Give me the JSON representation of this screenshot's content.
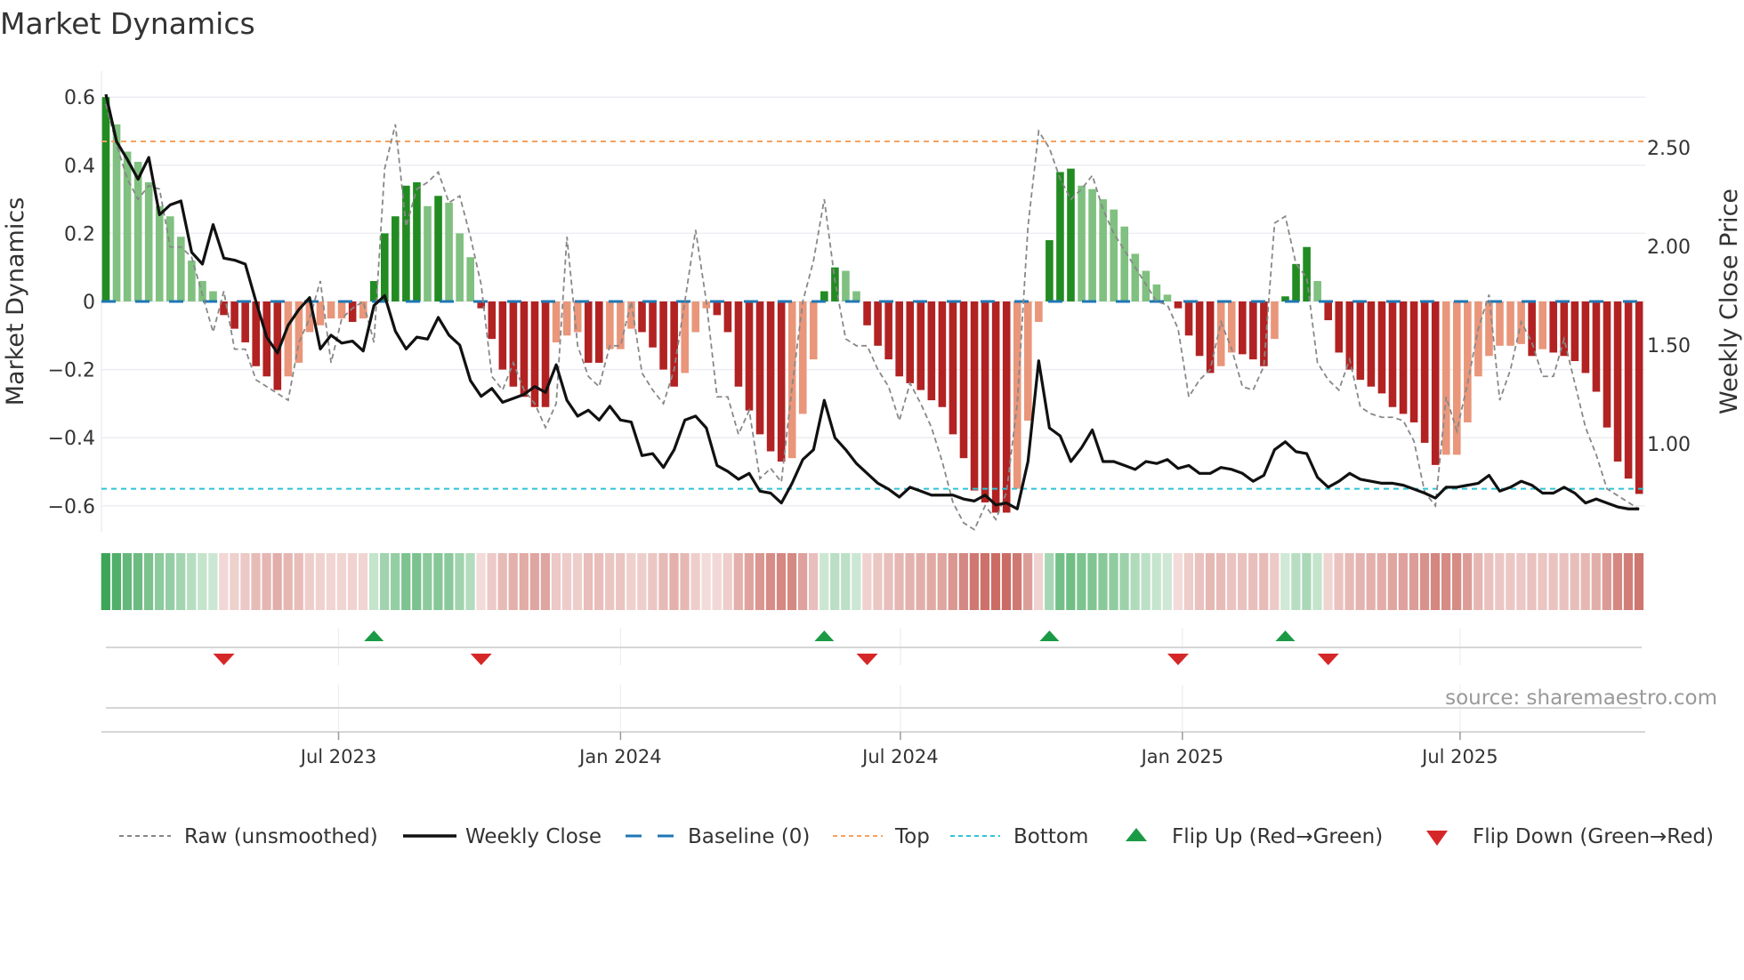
{
  "chart_data": {
    "type": "bar",
    "title": "Market Dynamics",
    "ylabel": "Market Dynamics",
    "ylabel_right": "Weekly Close Price",
    "ylim": [
      -0.68,
      0.68
    ],
    "ylim_right": [
      0.55,
      2.89
    ],
    "y_ticks": [
      "0.6",
      "0.4",
      "0.2",
      "0",
      "−0.2",
      "−0.4",
      "−0.6"
    ],
    "y_tick_values": [
      0.6,
      0.4,
      0.2,
      0,
      -0.2,
      -0.4,
      -0.6
    ],
    "y_right_ticks": [
      "2.50",
      "2.00",
      "1.50",
      "1.00"
    ],
    "y_right_tick_values": [
      2.5,
      2.0,
      1.5,
      1.0
    ],
    "x_ticks": [
      {
        "label": "Jul 2023",
        "week_index": 21.7
      },
      {
        "label": "Jan 2024",
        "week_index": 48.0
      },
      {
        "label": "Jul 2024",
        "week_index": 74.1
      },
      {
        "label": "Jan 2025",
        "week_index": 100.4
      },
      {
        "label": "Jul 2025",
        "week_index": 126.3
      }
    ],
    "top_level": 0.47,
    "bottom_level": -0.55,
    "baseline": 0,
    "market_dynamics": [
      0.6,
      0.52,
      0.44,
      0.41,
      0.35,
      0.28,
      0.25,
      0.19,
      0.12,
      0.06,
      0.03,
      -0.04,
      -0.08,
      -0.12,
      -0.19,
      -0.22,
      -0.26,
      -0.22,
      -0.18,
      -0.09,
      -0.07,
      -0.05,
      -0.05,
      -0.06,
      -0.05,
      0.06,
      0.2,
      0.25,
      0.34,
      0.35,
      0.28,
      0.31,
      0.29,
      0.2,
      0.13,
      -0.02,
      -0.11,
      -0.2,
      -0.25,
      -0.28,
      -0.31,
      -0.31,
      -0.12,
      -0.1,
      -0.09,
      -0.18,
      -0.18,
      -0.14,
      -0.14,
      -0.08,
      -0.09,
      -0.135,
      -0.2,
      -0.25,
      -0.21,
      -0.09,
      -0.02,
      -0.04,
      -0.09,
      -0.25,
      -0.32,
      -0.39,
      -0.44,
      -0.47,
      -0.46,
      -0.33,
      -0.17,
      0.03,
      0.1,
      0.09,
      0.03,
      -0.07,
      -0.13,
      -0.17,
      -0.22,
      -0.24,
      -0.26,
      -0.29,
      -0.31,
      -0.39,
      -0.46,
      -0.555,
      -0.59,
      -0.62,
      -0.62,
      -0.55,
      -0.35,
      -0.06,
      0.18,
      0.38,
      0.39,
      0.34,
      0.33,
      0.3,
      0.27,
      0.22,
      0.14,
      0.09,
      0.05,
      0.02,
      -0.02,
      -0.1,
      -0.16,
      -0.21,
      -0.19,
      -0.15,
      -0.155,
      -0.17,
      -0.19,
      -0.11,
      0.015,
      0.11,
      0.16,
      0.06,
      -0.055,
      -0.15,
      -0.2,
      -0.23,
      -0.25,
      -0.27,
      -0.31,
      -0.33,
      -0.355,
      -0.415,
      -0.48,
      -0.45,
      -0.45,
      -0.355,
      -0.22,
      -0.16,
      -0.13,
      -0.13,
      -0.125,
      -0.16,
      -0.14,
      -0.15,
      -0.16,
      -0.175,
      -0.21,
      -0.265,
      -0.37,
      -0.47,
      -0.52,
      -0.565
    ],
    "raw_unsmoothed": [
      0.58,
      0.46,
      0.36,
      0.3,
      0.34,
      0.33,
      0.16,
      0.16,
      0.13,
      0.02,
      -0.09,
      0.03,
      -0.14,
      -0.14,
      -0.23,
      -0.25,
      -0.27,
      -0.29,
      -0.12,
      -0.05,
      0.06,
      -0.18,
      -0.05,
      -0.02,
      0.0,
      -0.12,
      0.39,
      0.52,
      0.22,
      0.33,
      0.35,
      0.38,
      0.29,
      0.31,
      0.19,
      0.05,
      -0.22,
      -0.26,
      -0.18,
      -0.26,
      -0.3,
      -0.37,
      -0.3,
      0.19,
      -0.13,
      -0.22,
      -0.25,
      -0.13,
      -0.13,
      0.0,
      -0.21,
      -0.26,
      -0.3,
      -0.2,
      0.0,
      0.21,
      0.0,
      -0.28,
      -0.28,
      -0.39,
      -0.32,
      -0.52,
      -0.49,
      -0.53,
      -0.25,
      0.0,
      0.12,
      0.3,
      0.06,
      -0.11,
      -0.13,
      -0.13,
      -0.2,
      -0.25,
      -0.35,
      -0.24,
      -0.3,
      -0.37,
      -0.47,
      -0.59,
      -0.65,
      -0.67,
      -0.6,
      -0.64,
      -0.56,
      -0.3,
      0.22,
      0.5,
      0.45,
      0.36,
      0.3,
      0.33,
      0.37,
      0.27,
      0.2,
      0.15,
      0.1,
      0.05,
      0.0,
      -0.01,
      -0.08,
      -0.28,
      -0.23,
      -0.2,
      -0.06,
      -0.14,
      -0.25,
      -0.26,
      -0.19,
      0.23,
      0.25,
      0.11,
      0.07,
      -0.18,
      -0.23,
      -0.26,
      -0.17,
      -0.31,
      -0.33,
      -0.34,
      -0.34,
      -0.35,
      -0.41,
      -0.56,
      -0.6,
      -0.28,
      -0.38,
      -0.24,
      -0.08,
      0.02,
      -0.29,
      -0.2,
      -0.06,
      -0.12,
      -0.22,
      -0.22,
      -0.11,
      -0.24,
      -0.37,
      -0.45,
      -0.55,
      -0.57,
      -0.59,
      -0.61
    ],
    "weekly_close": [
      2.77,
      2.53,
      2.44,
      2.34,
      2.45,
      2.16,
      2.21,
      2.23,
      1.97,
      1.91,
      2.11,
      1.94,
      1.93,
      1.91,
      1.72,
      1.54,
      1.46,
      1.6,
      1.68,
      1.74,
      1.48,
      1.55,
      1.51,
      1.52,
      1.47,
      1.7,
      1.75,
      1.57,
      1.48,
      1.54,
      1.53,
      1.64,
      1.55,
      1.5,
      1.32,
      1.24,
      1.28,
      1.21,
      1.23,
      1.25,
      1.29,
      1.26,
      1.4,
      1.22,
      1.14,
      1.17,
      1.12,
      1.19,
      1.12,
      1.11,
      0.94,
      0.95,
      0.88,
      0.97,
      1.12,
      1.14,
      1.08,
      0.89,
      0.86,
      0.82,
      0.85,
      0.76,
      0.75,
      0.7,
      0.8,
      0.92,
      0.97,
      1.22,
      1.03,
      0.97,
      0.9,
      0.85,
      0.8,
      0.77,
      0.73,
      0.78,
      0.76,
      0.74,
      0.74,
      0.74,
      0.72,
      0.71,
      0.74,
      0.69,
      0.7,
      0.67,
      0.91,
      1.42,
      1.08,
      1.04,
      0.91,
      0.98,
      1.07,
      0.91,
      0.91,
      0.89,
      0.87,
      0.91,
      0.9,
      0.92,
      0.875,
      0.89,
      0.85,
      0.85,
      0.88,
      0.87,
      0.85,
      0.81,
      0.84,
      0.97,
      1.01,
      0.96,
      0.95,
      0.83,
      0.78,
      0.81,
      0.85,
      0.82,
      0.81,
      0.8,
      0.8,
      0.79,
      0.77,
      0.75,
      0.725,
      0.78,
      0.78,
      0.79,
      0.8,
      0.84,
      0.76,
      0.78,
      0.81,
      0.79,
      0.75,
      0.75,
      0.78,
      0.75,
      0.7,
      0.72,
      0.7,
      0.68,
      0.67,
      0.67
    ],
    "flip_up_weeks": [
      26,
      68,
      89,
      111
    ],
    "flip_down_weeks": [
      12,
      36,
      72,
      101,
      115
    ],
    "legend": {
      "placement": "bottom",
      "entries": [
        "Raw (unsmoothed)",
        "Weekly Close",
        "Baseline (0)",
        "Top",
        "Bottom",
        "Flip Up (Red→Green)",
        "Flip Down (Green→Red)"
      ]
    },
    "annotation": "source: sharemaestro.com",
    "grid": true
  },
  "colors": {
    "green_strong": "#228b22",
    "green_fading": "#80c080",
    "red_strong": "#b22222",
    "red_fading": "#e9967a",
    "close_line": "#111111",
    "raw_line": "#888888",
    "baseline": "#1f77b4",
    "top": "#f4a261",
    "bottom": "#2ec4d6",
    "flip_up": "#1a9a45",
    "flip_down": "#d62728"
  }
}
